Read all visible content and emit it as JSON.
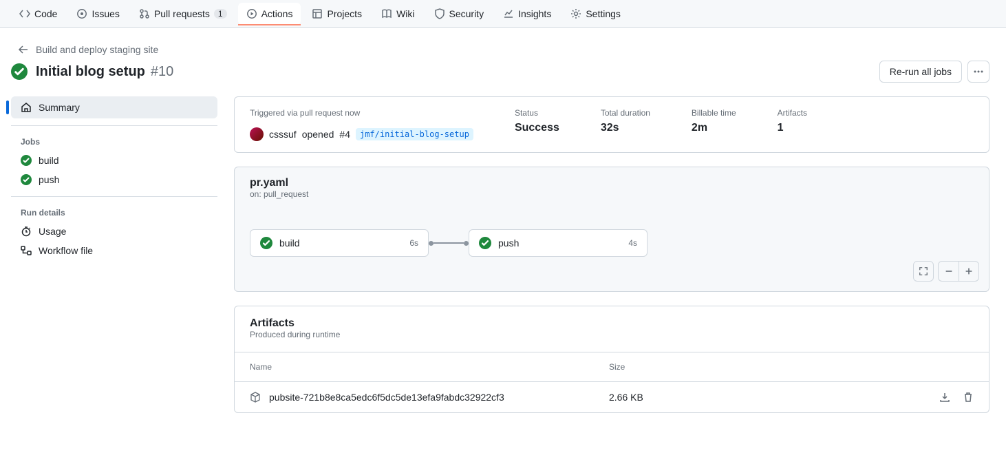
{
  "nav": {
    "code": "Code",
    "issues": "Issues",
    "pulls": "Pull requests",
    "pulls_count": "1",
    "actions": "Actions",
    "projects": "Projects",
    "wiki": "Wiki",
    "security": "Security",
    "insights": "Insights",
    "settings": "Settings"
  },
  "breadcrumb": "Build and deploy staging site",
  "title": "Initial blog setup",
  "run_number": "#10",
  "rerun_label": "Re-run all jobs",
  "sidebar": {
    "summary": "Summary",
    "jobs_heading": "Jobs",
    "jobs": [
      {
        "name": "build"
      },
      {
        "name": "push"
      }
    ],
    "rundetails_heading": "Run details",
    "usage": "Usage",
    "workflow_file": "Workflow file"
  },
  "summary": {
    "trigger_label": "Triggered via pull request now",
    "actor": "csssuf",
    "actor_action": "opened",
    "pr": "#4",
    "branch": "jmf/initial-blog-setup",
    "status_label": "Status",
    "status_val": "Success",
    "dur_label": "Total duration",
    "dur_val": "32s",
    "bill_label": "Billable time",
    "bill_val": "2m",
    "art_label": "Artifacts",
    "art_val": "1"
  },
  "graph": {
    "workflow": "pr.yaml",
    "on": "on: pull_request",
    "jobs": [
      {
        "name": "build",
        "dur": "6s"
      },
      {
        "name": "push",
        "dur": "4s"
      }
    ]
  },
  "artifacts": {
    "title": "Artifacts",
    "subtitle": "Produced during runtime",
    "th_name": "Name",
    "th_size": "Size",
    "rows": [
      {
        "name": "pubsite-721b8e8ca5edc6f5dc5de13efa9fabdc32922cf3",
        "size": "2.66 KB"
      }
    ]
  }
}
